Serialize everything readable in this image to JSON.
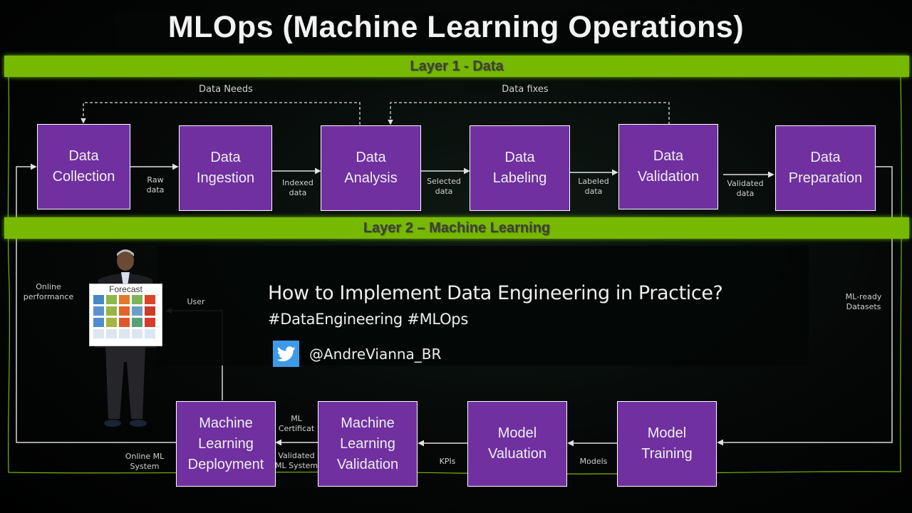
{
  "title": "MLOps (Machine Learning Operations)",
  "layers": [
    {
      "label": "Layer 1 - Data"
    },
    {
      "label": "Layer 2 – Machine Learning"
    }
  ],
  "layer1_feedback": {
    "data_needs": "Data Needs",
    "data_fixes": "Data fixes"
  },
  "layer1_steps": [
    {
      "line1": "Data",
      "line2": "Collection"
    },
    {
      "line1": "Data",
      "line2": "Ingestion"
    },
    {
      "line1": "Data",
      "line2": "Analysis"
    },
    {
      "line1": "Data",
      "line2": "Labeling"
    },
    {
      "line1": "Data",
      "line2": "Validation"
    },
    {
      "line1": "Data",
      "line2": "Preparation"
    }
  ],
  "layer1_edges": [
    {
      "line1": "Raw",
      "line2": "data"
    },
    {
      "line1": "Indexed",
      "line2": "data"
    },
    {
      "line1": "Selected",
      "line2": "data"
    },
    {
      "line1": "Labeled",
      "line2": "data"
    },
    {
      "line1": "Validated",
      "line2": "data"
    }
  ],
  "layer2_steps": [
    {
      "line1": "Machine",
      "line2": "Learning",
      "line3": "Deployment"
    },
    {
      "line1": "Machine",
      "line2": "Learning",
      "line3": "Validation"
    },
    {
      "line1": "Model",
      "line2": "Valuation"
    },
    {
      "line1": "Model",
      "line2": "Training"
    }
  ],
  "layer2_edges": {
    "ml_certificate": {
      "line1": "ML",
      "line2": "Certificat"
    },
    "validated_ml_system": {
      "line1": "Validated",
      "line2": "ML System"
    },
    "kpis": "KPIs",
    "models": "Models",
    "online_ml_system": {
      "line1": "Online ML",
      "line2": "System"
    },
    "ml_ready_datasets": {
      "line1": "ML-ready",
      "line2": "Datasets"
    },
    "online_performance": {
      "line1": "Online",
      "line2": "performance"
    },
    "user": "User"
  },
  "forecast_board": {
    "title": "Forecast"
  },
  "overlay": {
    "headline": "How to Implement Data Engineering in Practice?",
    "hashtags": "#DataEngineering #MLOps",
    "twitter_handle": "@AndreVianna_BR",
    "icon": "twitter-bird-icon"
  },
  "colors": {
    "accent_green": "#76b900",
    "box_purple": "#7030a0",
    "twitter_blue": "#3d9ae6"
  }
}
